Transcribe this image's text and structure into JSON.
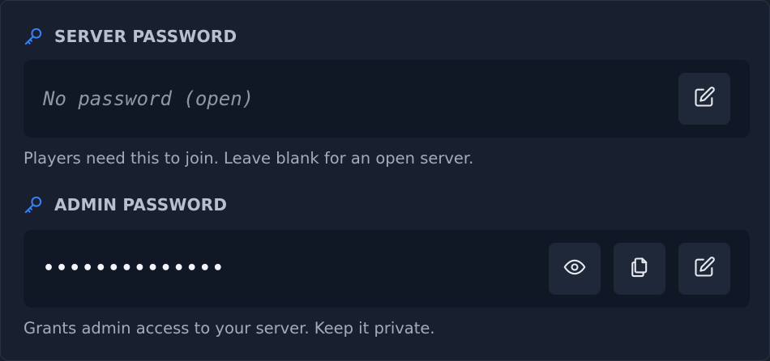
{
  "server_password": {
    "label": "SERVER PASSWORD",
    "value": "No password (open)",
    "hint": "Players need this to join. Leave blank for an open server.",
    "icon": "key-icon",
    "edit_icon": "edit-icon"
  },
  "admin_password": {
    "label": "ADMIN PASSWORD",
    "value": "••••••••••••••",
    "hint": "Grants admin access to your server. Keep it private.",
    "icon": "key-icon",
    "reveal_icon": "eye-icon",
    "copy_icon": "copy-icon",
    "edit_icon": "edit-icon"
  },
  "colors": {
    "accent": "#3b82f6",
    "panel_bg": "#182030",
    "field_bg": "#101725",
    "button_bg": "#1e2838",
    "label_text": "#b9c0cc",
    "hint_text": "#a5acb8"
  }
}
